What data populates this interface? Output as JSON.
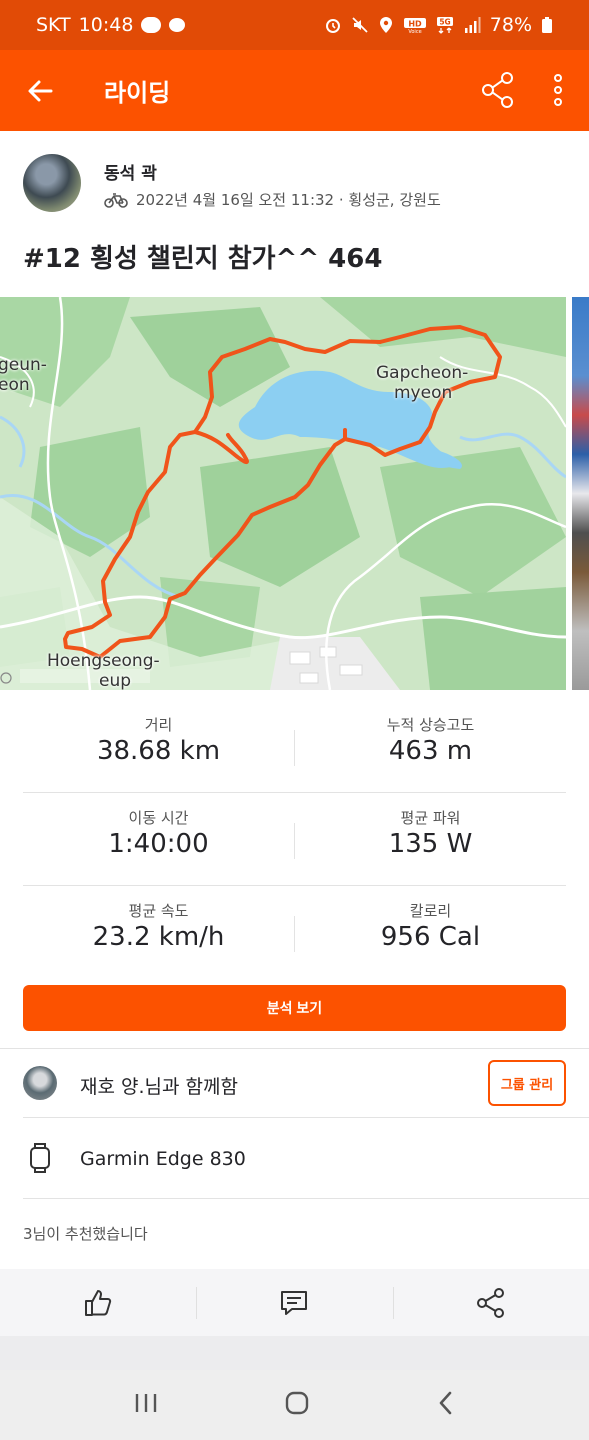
{
  "status_bar": {
    "carrier": "SKT",
    "time": "10:48",
    "battery": "78%",
    "icons": [
      "talk-icon",
      "chat-bubble-icon",
      "alarm-icon",
      "mute-icon",
      "location-icon",
      "hd-voice-icon",
      "5g-icon",
      "signal-icon",
      "battery-icon"
    ]
  },
  "app_bar": {
    "title": "라이딩"
  },
  "athlete": {
    "name": "동석 곽",
    "date_location": "2022년 4월 16일 오전 11:32 · 횡성군, 강원도"
  },
  "activity": {
    "title": "#12 횡성 챌린지 참가^^ 464"
  },
  "map": {
    "labels": {
      "gapcheon1": "Gapcheon-",
      "gapcheon2": "myeon",
      "left1": "geun-",
      "left2": "eon",
      "hoengseong1": "Hoengseong-",
      "hoengseong2": "eup"
    },
    "route_color": "#f0541a"
  },
  "stats": [
    {
      "label": "거리",
      "value": "38.68 km"
    },
    {
      "label": "누적 상승고도",
      "value": "463 m"
    },
    {
      "label": "이동 시간",
      "value": "1:40:00"
    },
    {
      "label": "평균 파워",
      "value": "135 W"
    },
    {
      "label": "평균 속도",
      "value": "23.2 km/h"
    },
    {
      "label": "칼로리",
      "value": "956 Cal"
    }
  ],
  "analysis_button": "분석 보기",
  "group": {
    "text": "재호 양.님과 함께함",
    "button": "그룹 관리"
  },
  "device": {
    "name": "Garmin Edge 830"
  },
  "kudos": "3님이 추천했습니다",
  "colors": {
    "brand": "#fc5200",
    "status_bar": "#e14b06"
  }
}
